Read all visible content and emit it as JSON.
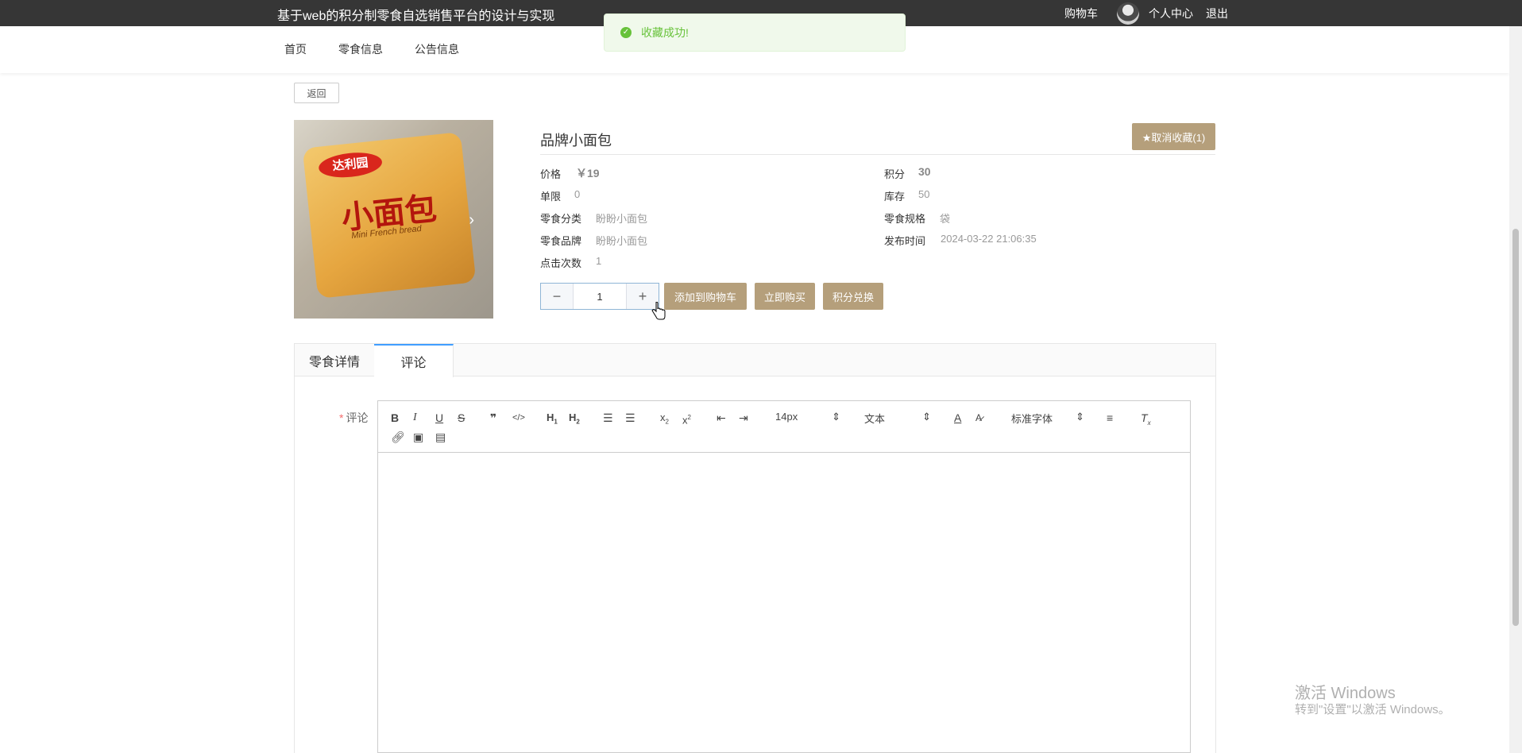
{
  "header": {
    "site_title": "基于web的积分制零食自选销售平台的设计与实现",
    "cart_label": "购物车",
    "personal_center_label": "个人中心",
    "logout_label": "退出"
  },
  "nav": {
    "items": [
      {
        "label": "首页"
      },
      {
        "label": "零食信息"
      },
      {
        "label": "公告信息"
      }
    ]
  },
  "toast": {
    "message": "收藏成功!",
    "icon": "check-circle-icon",
    "color": "#67c23a"
  },
  "back_button": "返回",
  "product": {
    "name": "品牌小面包",
    "favorite_button": "★取消收藏(1)",
    "image": {
      "brand_text": "达利园",
      "main_text": "小面包",
      "sub_text": "Mini French bread"
    },
    "fields": {
      "price_label": "价格",
      "price_value": "￥19",
      "points_label": "积分",
      "points_value": "30",
      "limit_label": "单限",
      "limit_value": "0",
      "stock_label": "库存",
      "stock_value": "50",
      "category_label": "零食分类",
      "category_value": "盼盼小面包",
      "spec_label": "零食规格",
      "spec_value": "袋",
      "brand_label": "零食品牌",
      "brand_value": "盼盼小面包",
      "publish_time_label": "发布时间",
      "publish_time_value": "2024-03-22 21:06:35",
      "clicks_label": "点击次数",
      "clicks_value": "1"
    },
    "quantity": "1",
    "add_to_cart_label": "添加到购物车",
    "buy_now_label": "立即购买",
    "points_exchange_label": "积分兑换"
  },
  "tabs": [
    {
      "label": "零食详情",
      "active": false
    },
    {
      "label": "评论",
      "active": true
    }
  ],
  "comment": {
    "label": "评论",
    "required_mark": "*",
    "toolbar": {
      "font_size": "14px",
      "block_type": "文本",
      "font_family": "标准字体"
    }
  },
  "watermark": {
    "line1": "激活 Windows",
    "line2": "转到\"设置\"以激活 Windows。"
  },
  "colors": {
    "accent": "#b59f7b",
    "topbar": "#363636",
    "tab_active": "#409eff"
  }
}
